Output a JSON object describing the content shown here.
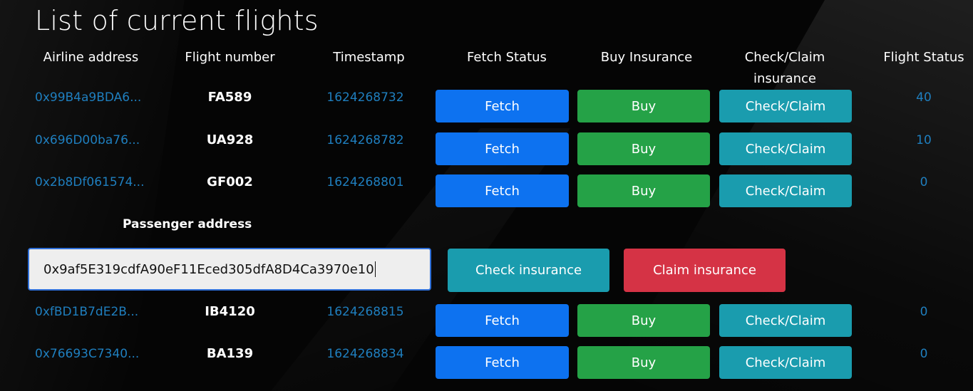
{
  "page": {
    "title": "List of current flights"
  },
  "table": {
    "headers": {
      "airline": "Airline address",
      "flight": "Flight number",
      "timestamp": "Timestamp",
      "fetch": "Fetch Status",
      "buy": "Buy Insurance",
      "check_line1": "Check/Claim",
      "check_line2": "insurance",
      "status": "Flight Status"
    },
    "rows": [
      {
        "airline": "0x99B4a9BDA6...",
        "flight": "FA589",
        "timestamp": "1624268732",
        "fetch": "Fetch",
        "buy": "Buy",
        "check": "Check/Claim",
        "status": "40"
      },
      {
        "airline": "0x696D00ba76...",
        "flight": "UA928",
        "timestamp": "1624268782",
        "fetch": "Fetch",
        "buy": "Buy",
        "check": "Check/Claim",
        "status": "10"
      },
      {
        "airline": "0x2b8Df061574...",
        "flight": "GF002",
        "timestamp": "1624268801",
        "fetch": "Fetch",
        "buy": "Buy",
        "check": "Check/Claim",
        "status": "0"
      },
      {
        "airline": "0xfBD1B7dE2B...",
        "flight": "IB4120",
        "timestamp": "1624268815",
        "fetch": "Fetch",
        "buy": "Buy",
        "check": "Check/Claim",
        "status": "0"
      },
      {
        "airline": "0x76693C7340...",
        "flight": "BA139",
        "timestamp": "1624268834",
        "fetch": "Fetch",
        "buy": "Buy",
        "check": "Check/Claim",
        "status": "0"
      }
    ]
  },
  "passenger": {
    "label": "Passenger address",
    "value": "0x9af5E319cdfA90eF11Eced305dfA8D4Ca3970e10",
    "check_button": "Check insurance",
    "claim_button": "Claim insurance"
  },
  "colors": {
    "link": "#1f7fbf",
    "fetch": "#0d72f0",
    "buy": "#25a247",
    "check": "#1a9cae",
    "claim": "#d53345"
  }
}
